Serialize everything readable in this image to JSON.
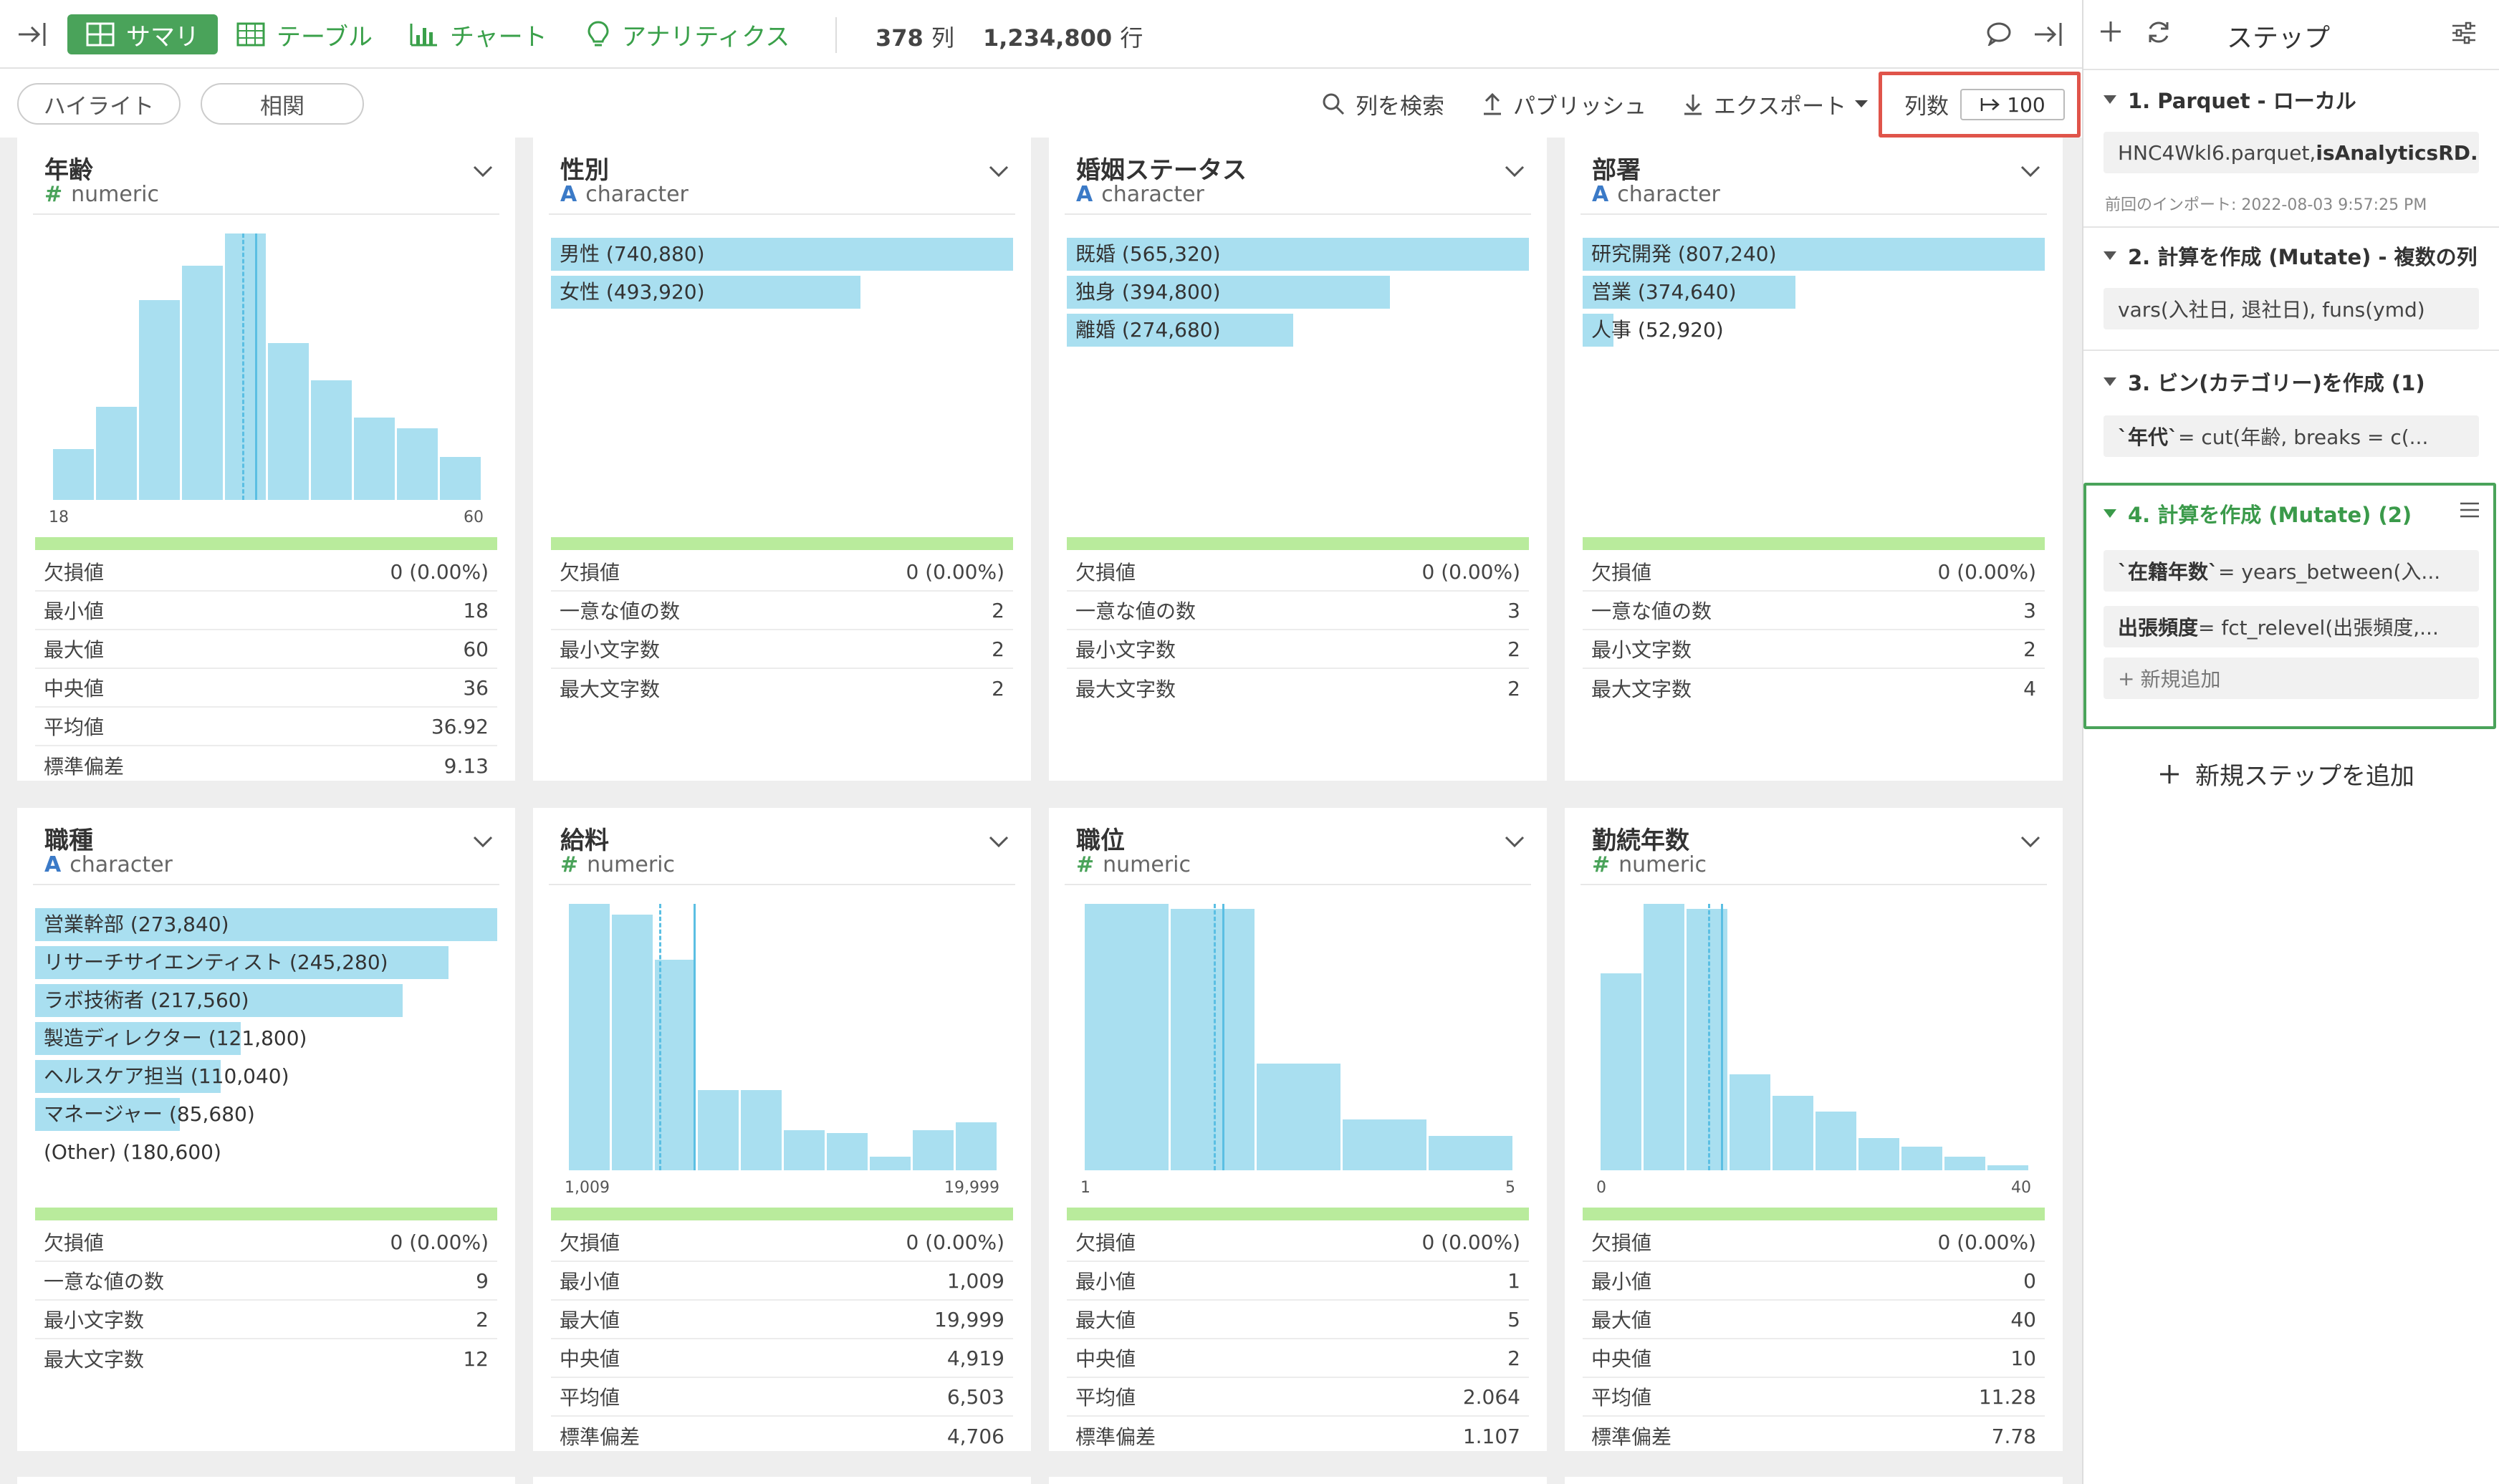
{
  "topbar": {
    "tabs": [
      {
        "label": "サマリ",
        "icon": "grid-icon"
      },
      {
        "label": "テーブル",
        "icon": "table-icon"
      },
      {
        "label": "チャート",
        "icon": "bar-chart-icon"
      },
      {
        "label": "アナリティクス",
        "icon": "lightbulb-icon"
      }
    ],
    "columns_count": "378",
    "columns_unit": "列",
    "rows_count": "1,234,800",
    "rows_unit": "行"
  },
  "subbar": {
    "highlight_label": "ハイライト",
    "correlation_label": "相関",
    "search_label": "列を検索",
    "publish_label": "パブリッシュ",
    "export_label": "エクスポート",
    "column_count_label": "列数",
    "column_count_value": "100"
  },
  "cards": [
    {
      "title": "年齢",
      "type_icon": "#",
      "type": "numeric",
      "min_label": "18",
      "max_label": "60",
      "histogram": [
        0.19,
        0.35,
        0.75,
        0.88,
        1.0,
        0.59,
        0.45,
        0.31,
        0.27,
        0.16
      ],
      "lines": [
        0.44,
        0.47
      ],
      "stats": [
        [
          "欠損値",
          "0 (0.00%)"
        ],
        [
          "最小値",
          "18"
        ],
        [
          "最大値",
          "60"
        ],
        [
          "中央値",
          "36"
        ],
        [
          "平均値",
          "36.92"
        ],
        [
          "標準偏差",
          "9.13"
        ]
      ]
    },
    {
      "title": "性別",
      "type_icon": "A",
      "type": "character",
      "categories": [
        {
          "label": "男性 (740,880)",
          "frac": 1.0
        },
        {
          "label": "女性 (493,920)",
          "frac": 0.67
        }
      ],
      "stats": [
        [
          "欠損値",
          "0 (0.00%)"
        ],
        [
          "一意な値の数",
          "2"
        ],
        [
          "最小文字数",
          "2"
        ],
        [
          "最大文字数",
          "2"
        ]
      ]
    },
    {
      "title": "婚姻ステータス",
      "type_icon": "A",
      "type": "character",
      "categories": [
        {
          "label": "既婚 (565,320)",
          "frac": 1.0
        },
        {
          "label": "独身 (394,800)",
          "frac": 0.7
        },
        {
          "label": "離婚 (274,680)",
          "frac": 0.49
        }
      ],
      "stats": [
        [
          "欠損値",
          "0 (0.00%)"
        ],
        [
          "一意な値の数",
          "3"
        ],
        [
          "最小文字数",
          "2"
        ],
        [
          "最大文字数",
          "2"
        ]
      ]
    },
    {
      "title": "部署",
      "type_icon": "A",
      "type": "character",
      "categories": [
        {
          "label": "研究開発 (807,240)",
          "frac": 1.0
        },
        {
          "label": "営業 (374,640)",
          "frac": 0.46
        },
        {
          "label": "人事 (52,920)",
          "frac": 0.066
        }
      ],
      "stats": [
        [
          "欠損値",
          "0 (0.00%)"
        ],
        [
          "一意な値の数",
          "3"
        ],
        [
          "最小文字数",
          "2"
        ],
        [
          "最大文字数",
          "4"
        ]
      ]
    },
    {
      "title": "職種",
      "type_icon": "A",
      "type": "character",
      "categories": [
        {
          "label": "営業幹部 (273,840)",
          "frac": 1.0
        },
        {
          "label": "リサーチサイエンティスト (245,280)",
          "frac": 0.895
        },
        {
          "label": "ラボ技術者 (217,560)",
          "frac": 0.795
        },
        {
          "label": "製造ディレクター (121,800)",
          "frac": 0.445
        },
        {
          "label": "ヘルスケア担当 (110,040)",
          "frac": 0.402
        },
        {
          "label": "マネージャー (85,680)",
          "frac": 0.313
        },
        {
          "label": "(Other) (180,600)",
          "frac": 0
        }
      ],
      "stats": [
        [
          "欠損値",
          "0 (0.00%)"
        ],
        [
          "一意な値の数",
          "9"
        ],
        [
          "最小文字数",
          "2"
        ],
        [
          "最大文字数",
          "12"
        ]
      ]
    },
    {
      "title": "給料",
      "type_icon": "#",
      "type": "numeric",
      "min_label": "1,009",
      "max_label": "19,999",
      "histogram": [
        1.0,
        0.96,
        0.79,
        0.3,
        0.3,
        0.15,
        0.14,
        0.05,
        0.15,
        0.18
      ],
      "lines": [
        0.21,
        0.29
      ],
      "stats": [
        [
          "欠損値",
          "0 (0.00%)"
        ],
        [
          "最小値",
          "1,009"
        ],
        [
          "最大値",
          "19,999"
        ],
        [
          "中央値",
          "4,919"
        ],
        [
          "平均値",
          "6,503"
        ],
        [
          "標準偏差",
          "4,706"
        ]
      ]
    },
    {
      "title": "職位",
      "type_icon": "#",
      "type": "numeric",
      "min_label": "1",
      "max_label": "5",
      "histogram": [
        1.0,
        0.98,
        0.4,
        0.19,
        0.13
      ],
      "lines": [
        0.3,
        0.32
      ],
      "stats": [
        [
          "欠損値",
          "0 (0.00%)"
        ],
        [
          "最小値",
          "1"
        ],
        [
          "最大値",
          "5"
        ],
        [
          "中央値",
          "2"
        ],
        [
          "平均値",
          "2.064"
        ],
        [
          "標準偏差",
          "1.107"
        ]
      ]
    },
    {
      "title": "勤続年数",
      "type_icon": "#",
      "type": "numeric",
      "min_label": "0",
      "max_label": "40",
      "histogram": [
        0.74,
        1.0,
        0.98,
        0.36,
        0.28,
        0.22,
        0.12,
        0.09,
        0.05,
        0.02
      ],
      "lines": [
        0.25,
        0.28
      ],
      "stats": [
        [
          "欠損値",
          "0 (0.00%)"
        ],
        [
          "最小値",
          "0"
        ],
        [
          "最大値",
          "40"
        ],
        [
          "中央値",
          "10"
        ],
        [
          "平均値",
          "11.28"
        ],
        [
          "標準偏差",
          "7.78"
        ]
      ]
    }
  ],
  "steps_panel": {
    "title": "ステップ",
    "steps": [
      {
        "title": "1. Parquet - ローカル",
        "lines": [
          {
            "plain": "HNC4Wkl6.parquet, ",
            "bold": "isAnalyticsRD..."
          }
        ],
        "meta": "前回のインポート: 2022-08-03 9:57:25 PM"
      },
      {
        "title": "2. 計算を作成 (Mutate) - 複数の列",
        "lines": [
          {
            "plain": "vars(入社日, 退社日), funs(ymd)",
            "bold": ""
          }
        ]
      },
      {
        "title": "3. ビン(カテゴリー)を作成 (1)",
        "lines": [
          {
            "bold": "`年代`",
            "plain": " = cut(年齢, breaks = c(..."
          }
        ]
      },
      {
        "title": "4. 計算を作成 (Mutate) (2)",
        "lines": [
          {
            "bold": "`在籍年数`",
            "plain": " = years_between(入..."
          },
          {
            "bold": "出張頻度",
            "plain": " = fct_relevel(出張頻度,..."
          }
        ],
        "add_new": "新規追加"
      }
    ],
    "add_step_label": "新規ステップを追加"
  },
  "colors": {
    "accent_green": "#4aa35a",
    "bar_blue": "#a9dff0",
    "highlight_red": "#e0544a",
    "selected_step_green": "#4aa35a"
  }
}
